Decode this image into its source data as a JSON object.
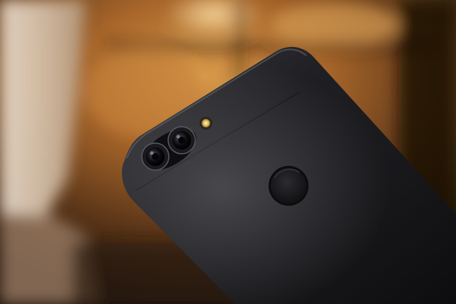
{
  "photo": {
    "subject": "phone-back-dual-camera",
    "colors": {
      "phone_body": "#1c1c1f",
      "background_warm": "#b8742e",
      "background_dark": "#2a1a0e",
      "flash": "#e8c56a",
      "curtain": "#d9c9b8"
    }
  }
}
